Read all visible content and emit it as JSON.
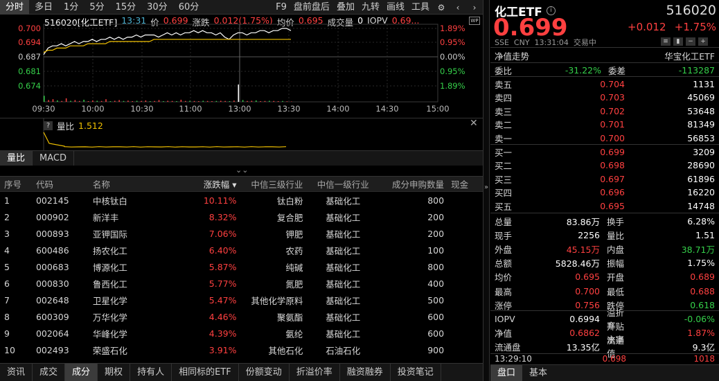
{
  "period_tabs": [
    "分时",
    "多日",
    "1分",
    "5分",
    "15分",
    "30分",
    "60分"
  ],
  "period_active": 0,
  "top_right": [
    "F9",
    "盘前盘后",
    "叠加",
    "九转",
    "画线",
    "工具"
  ],
  "info": {
    "code_name": "516020[化工ETF]",
    "time": "13:31",
    "price_label": "价",
    "price": "0.699",
    "change_label": "涨跌",
    "change": "0.012(1.75%)",
    "avg_label": "均价",
    "avg": "0.695",
    "vol_label": "成交量",
    "vol": "0",
    "iopv_label": "IOPV",
    "iopv": "0.69..."
  },
  "y_left": [
    "0.700",
    "0.694",
    "0.687",
    "0.681",
    "0.674"
  ],
  "y_right": [
    "1.89%",
    "0.95%",
    "0.00%",
    "0.95%",
    "1.89%"
  ],
  "x_times": [
    "09:30",
    "10:00",
    "10:30",
    "11:00",
    "11:30",
    "13:00",
    "13:30",
    "14:00",
    "14:30",
    "15:00"
  ],
  "colors": {
    "up": "#ff4040",
    "down": "#35d04a",
    "price": "#ffffff",
    "avg": "#f0c000",
    "bg": "#000000",
    "grid": "#2a2a2a"
  },
  "price_series": [
    0.688,
    0.691,
    0.692,
    0.692,
    0.693,
    0.692,
    0.693,
    0.694,
    0.693,
    0.694,
    0.694,
    0.695,
    0.694,
    0.695,
    0.695,
    0.696,
    0.695,
    0.696,
    0.695,
    0.696,
    0.696,
    0.697,
    0.696,
    0.697,
    0.697,
    0.697,
    0.696,
    0.697,
    0.698,
    0.697,
    0.698,
    0.697,
    0.698,
    0.698,
    0.699,
    0.698,
    0.699,
    0.698,
    0.698,
    0.697,
    0.698,
    0.696,
    0.695,
    0.697,
    0.698,
    0.698,
    0.697,
    0.698,
    0.698,
    0.699,
    0.699,
    0.698,
    0.699,
    0.699,
    0.7,
    0.7,
    0.699
  ],
  "avg_series": [
    0.689,
    0.69,
    0.69,
    0.691,
    0.691,
    0.691,
    0.692,
    0.692,
    0.692,
    0.692,
    0.693,
    0.693,
    0.693,
    0.693,
    0.693,
    0.694,
    0.694,
    0.694,
    0.694,
    0.694,
    0.694,
    0.694,
    0.694,
    0.694,
    0.694,
    0.695,
    0.695,
    0.695,
    0.695,
    0.695,
    0.695,
    0.695,
    0.695,
    0.695,
    0.695,
    0.695,
    0.695,
    0.695,
    0.695,
    0.695,
    0.695,
    0.695,
    0.695,
    0.695,
    0.695,
    0.695,
    0.695,
    0.695,
    0.695,
    0.695,
    0.695,
    0.695,
    0.695,
    0.695,
    0.695,
    0.695,
    0.695
  ],
  "volume_bars": [
    0.35,
    0.1,
    0.15,
    0.08,
    0.05,
    0.2,
    0.06,
    0.1,
    0.05,
    0.12,
    0.04,
    0.08,
    0.06,
    0.05,
    0.15,
    0.04,
    0.06,
    0.1,
    0.05,
    0.07,
    0.04,
    0.06,
    0.05,
    0.08,
    0.04,
    0.05,
    0.1,
    0.04,
    0.06,
    0.05,
    0.04,
    0.12,
    0.05,
    0.06,
    0.05,
    0.04,
    0.06,
    0.05,
    0.04,
    0.05,
    0.06,
    0.05,
    0.04,
    0.07,
    1.0,
    0.1,
    0.05,
    0.06,
    0.08,
    0.04,
    0.05,
    0.06,
    0.05,
    0.04,
    0.05,
    0.03,
    0.02
  ],
  "volratio": {
    "label": "量比",
    "value": "1.512"
  },
  "ind_tabs": [
    "量比",
    "MACD"
  ],
  "table": {
    "headers": [
      "序号",
      "代码",
      "名称",
      "涨跌幅 ▾",
      "中信三级行业",
      "中信一级行业",
      "成分申购数量",
      "现金"
    ],
    "rows": [
      [
        "1",
        "002145",
        "中核钛白",
        "10.11%",
        "钛白粉",
        "基础化工",
        "800"
      ],
      [
        "2",
        "000902",
        "新洋丰",
        "8.32%",
        "复合肥",
        "基础化工",
        "200"
      ],
      [
        "3",
        "000893",
        "亚钾国际",
        "7.06%",
        "钾肥",
        "基础化工",
        "200"
      ],
      [
        "4",
        "600486",
        "扬农化工",
        "6.40%",
        "农药",
        "基础化工",
        "100"
      ],
      [
        "5",
        "000683",
        "博源化工",
        "5.87%",
        "纯碱",
        "基础化工",
        "800"
      ],
      [
        "6",
        "000830",
        "鲁西化工",
        "5.77%",
        "氮肥",
        "基础化工",
        "400"
      ],
      [
        "7",
        "002648",
        "卫星化学",
        "5.47%",
        "其他化学原料",
        "基础化工",
        "500"
      ],
      [
        "8",
        "600309",
        "万华化学",
        "4.46%",
        "聚氨酯",
        "基础化工",
        "600"
      ],
      [
        "9",
        "002064",
        "华峰化学",
        "4.39%",
        "氨纶",
        "基础化工",
        "600"
      ],
      [
        "10",
        "002493",
        "荣盛石化",
        "3.91%",
        "其他石化",
        "石油石化",
        "900"
      ]
    ]
  },
  "bottom_tabs": [
    "资讯",
    "成交",
    "成分",
    "期权",
    "持有人",
    "相同标的ETF",
    "份额变动",
    "折溢价率",
    "融资融券",
    "投资笔记"
  ],
  "bottom_active": 2,
  "quote": {
    "name": "化工ETF",
    "info_icon": "i",
    "code": "516020",
    "price": "0.699",
    "change": "+0.012",
    "change_pct": "+1.75%",
    "meta": "SSE  CNY  13:31:04  交易中",
    "nav_label": "净值走势",
    "fund_name": "华宝化工ETF",
    "weibi_label": "委比",
    "weibi": "-31.22%",
    "weicha_label": "委差",
    "weicha": "-113287"
  },
  "asks": [
    {
      "l": "卖五",
      "p": "0.704",
      "v": "1131"
    },
    {
      "l": "卖四",
      "p": "0.703",
      "v": "45069"
    },
    {
      "l": "卖三",
      "p": "0.702",
      "v": "53648"
    },
    {
      "l": "卖二",
      "p": "0.701",
      "v": "81349"
    },
    {
      "l": "卖一",
      "p": "0.700",
      "v": "56853"
    }
  ],
  "bids": [
    {
      "l": "买一",
      "p": "0.699",
      "v": "3209"
    },
    {
      "l": "买二",
      "p": "0.698",
      "v": "28690"
    },
    {
      "l": "买三",
      "p": "0.697",
      "v": "61896"
    },
    {
      "l": "买四",
      "p": "0.696",
      "v": "16220"
    },
    {
      "l": "买五",
      "p": "0.695",
      "v": "14748"
    }
  ],
  "stats": [
    {
      "l1": "总量",
      "v1": "83.86万",
      "c1": "white",
      "l2": "换手",
      "v2": "6.28%",
      "c2": "white"
    },
    {
      "l1": "现手",
      "v1": "2256",
      "c1": "white",
      "l2": "量比",
      "v2": "1.51",
      "c2": "white"
    },
    {
      "l1": "外盘",
      "v1": "45.15万",
      "c1": "red",
      "l2": "内盘",
      "v2": "38.71万",
      "c2": "green"
    },
    {
      "l1": "总额",
      "v1": "5828.46万",
      "c1": "white",
      "l2": "振幅",
      "v2": "1.75%",
      "c2": "white"
    },
    {
      "l1": "均价",
      "v1": "0.695",
      "c1": "red",
      "l2": "开盘",
      "v2": "0.689",
      "c2": "red"
    },
    {
      "l1": "最高",
      "v1": "0.700",
      "c1": "red",
      "l2": "最低",
      "v2": "0.688",
      "c2": "red"
    },
    {
      "l1": "涨停",
      "v1": "0.756",
      "c1": "red",
      "l2": "跌停",
      "v2": "0.618",
      "c2": "green"
    }
  ],
  "stats2": [
    {
      "l1": "IOPV",
      "v1": "0.6994",
      "c1": "white",
      "l2": "溢折率",
      "v2": "-0.06%",
      "c2": "green"
    },
    {
      "l1": "净值",
      "v1": "0.6862",
      "c1": "red",
      "l2": "升贴水率",
      "v2": "1.87%",
      "c2": "red"
    },
    {
      "l1": "流通盘",
      "v1": "13.35亿",
      "c1": "white",
      "l2": "流通值",
      "v2": "9.3亿",
      "c2": "white"
    }
  ],
  "tick_peek": {
    "time": "13:29:10",
    "price": "0.698",
    "vol": "1018"
  },
  "rp_tabs": [
    "盘口",
    "基本"
  ]
}
